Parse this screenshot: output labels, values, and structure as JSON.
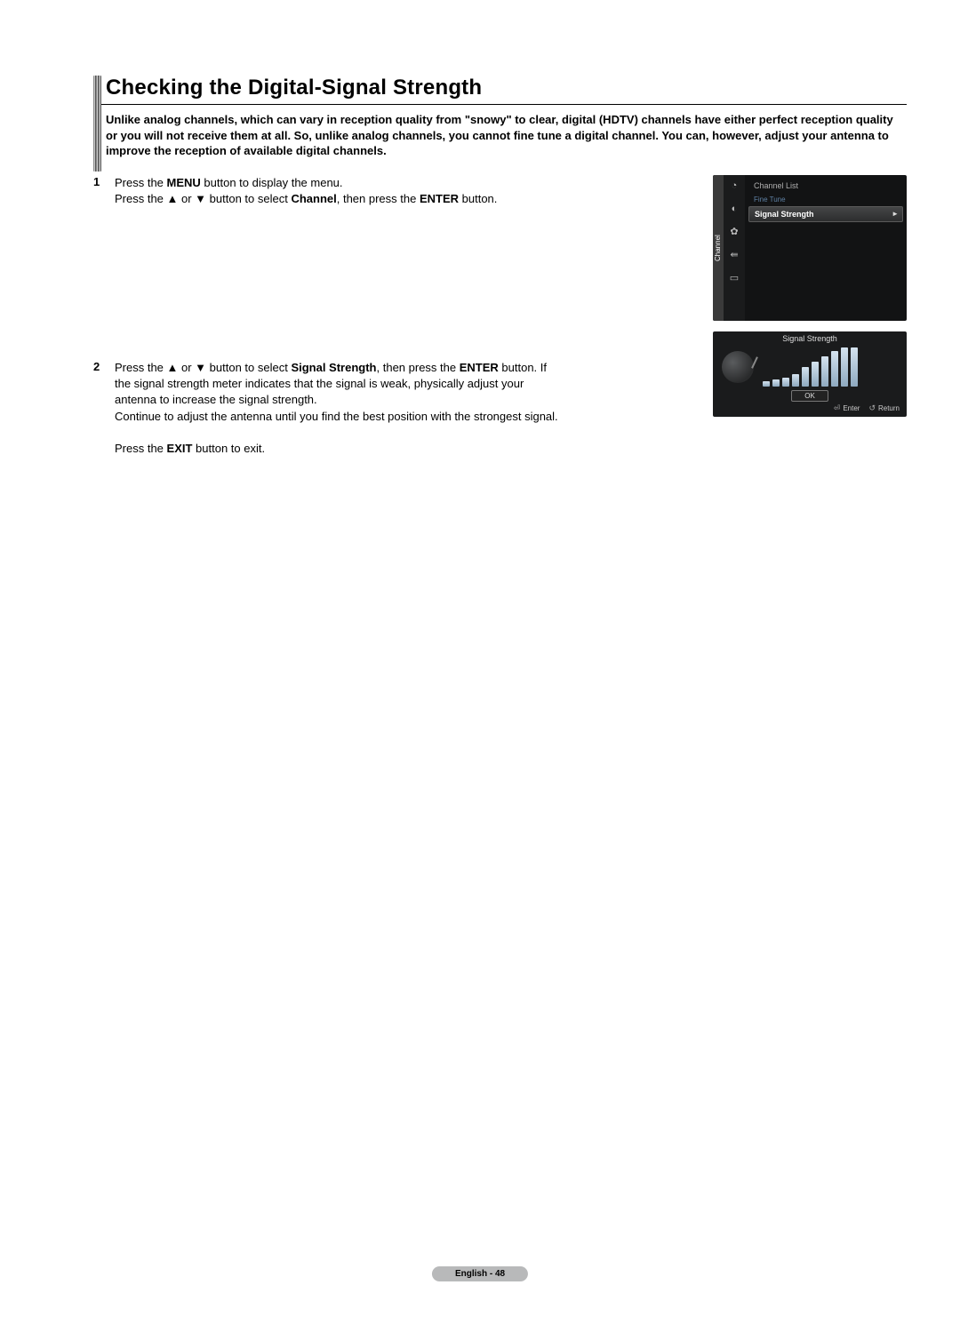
{
  "title": "Checking the Digital-Signal Strength",
  "intro": "Unlike analog channels, which can vary in reception quality from \"snowy\" to clear, digital (HDTV) channels have either perfect reception quality or you will not receive them at all. So, unlike analog channels, you cannot fine tune a digital channel. You can, however, adjust your antenna to improve the reception of available digital channels.",
  "steps": [
    {
      "num": "1",
      "parts": [
        {
          "t": "Press the ",
          "b": false
        },
        {
          "t": "MENU",
          "b": true
        },
        {
          "t": " button to display the menu.",
          "b": false
        },
        {
          "t": "\nPress the ▲ or ▼ button to select ",
          "b": false
        },
        {
          "t": "Channel",
          "b": true
        },
        {
          "t": ", then press the ",
          "b": false
        },
        {
          "t": "ENTER",
          "b": true
        },
        {
          "t": " button.",
          "b": false
        }
      ]
    },
    {
      "num": "2",
      "parts": [
        {
          "t": "Press the ▲ or ▼ button to select ",
          "b": false
        },
        {
          "t": "Signal Strength",
          "b": true
        },
        {
          "t": ", then press the ",
          "b": false
        },
        {
          "t": "ENTER",
          "b": true
        },
        {
          "t": " button. If the signal strength meter indicates that the signal is weak, physically adjust your antenna to increase the signal strength.",
          "b": false
        },
        {
          "t": "\nContinue to adjust the antenna until you find the best position with the strongest signal.",
          "b": false
        },
        {
          "t": "\n\nPress the ",
          "b": false
        },
        {
          "t": "EXIT",
          "b": true
        },
        {
          "t": " button to exit.",
          "b": false
        }
      ]
    }
  ],
  "tvmenu": {
    "category": "Channel",
    "items": [
      {
        "label": "Channel List",
        "selected": false,
        "sub": false
      },
      {
        "label": "Fine Tune",
        "selected": false,
        "sub": true
      },
      {
        "label": "Signal Strength",
        "selected": true,
        "sub": false
      }
    ]
  },
  "signal": {
    "title": "Signal Strength",
    "bars": [
      6,
      8,
      10,
      14,
      22,
      28,
      34,
      40,
      44,
      44
    ],
    "ok": "OK",
    "enter": "Enter",
    "return": "Return"
  },
  "footer": "English - 48"
}
